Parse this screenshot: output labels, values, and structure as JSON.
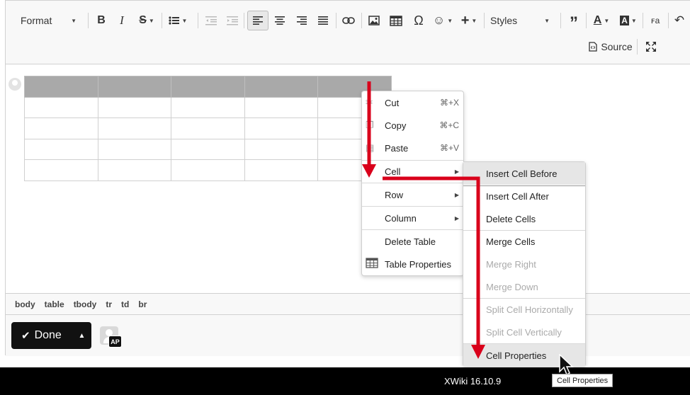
{
  "toolbar": {
    "format_label": "Format",
    "styles_label": "Styles",
    "source_label": "Source",
    "icons": [
      "bold-icon",
      "italic-icon",
      "strikethrough-icon",
      "bulleted-list-icon",
      "outdent-icon",
      "indent-icon",
      "align-left-icon",
      "align-center-icon",
      "align-right-icon",
      "justify-icon",
      "link-icon",
      "image-icon",
      "table-icon",
      "special-char-icon",
      "emoji-icon",
      "insert-plus-icon",
      "blockquote-icon",
      "text-color-icon",
      "background-color-icon",
      "text-direction-icon",
      "undo-icon",
      "source-icon",
      "maximize-icon"
    ]
  },
  "table": {
    "rows": 5,
    "cols": 5,
    "header_color": "#a9a9a9"
  },
  "context_menu": {
    "items": [
      {
        "label": "Cut",
        "shortcut": "⌘+X"
      },
      {
        "label": "Copy",
        "shortcut": "⌘+C"
      },
      {
        "label": "Paste",
        "shortcut": "⌘+V"
      },
      {
        "label": "Cell"
      },
      {
        "label": "Row"
      },
      {
        "label": "Column"
      },
      {
        "label": "Delete Table"
      },
      {
        "label": "Table Properties"
      }
    ]
  },
  "cell_menu": {
    "items": [
      {
        "label": "Insert Cell Before",
        "highlighted": true
      },
      {
        "label": "Insert Cell After"
      },
      {
        "label": "Delete Cells"
      },
      {
        "label": "Merge Cells"
      },
      {
        "label": "Merge Right",
        "disabled": true
      },
      {
        "label": "Merge Down",
        "disabled": true
      },
      {
        "label": "Split Cell Horizontally",
        "disabled": true
      },
      {
        "label": "Split Cell Vertically",
        "disabled": true
      },
      {
        "label": "Cell Properties",
        "highlighted": true
      }
    ]
  },
  "element_path": [
    "body",
    "table",
    "tbody",
    "tr",
    "td",
    "br"
  ],
  "done_label": "Done",
  "user_initials": "AP",
  "footer_text": "XWiki 16.10.9",
  "tooltip_text": "Cell Properties",
  "annotation_color": "#d9001b"
}
